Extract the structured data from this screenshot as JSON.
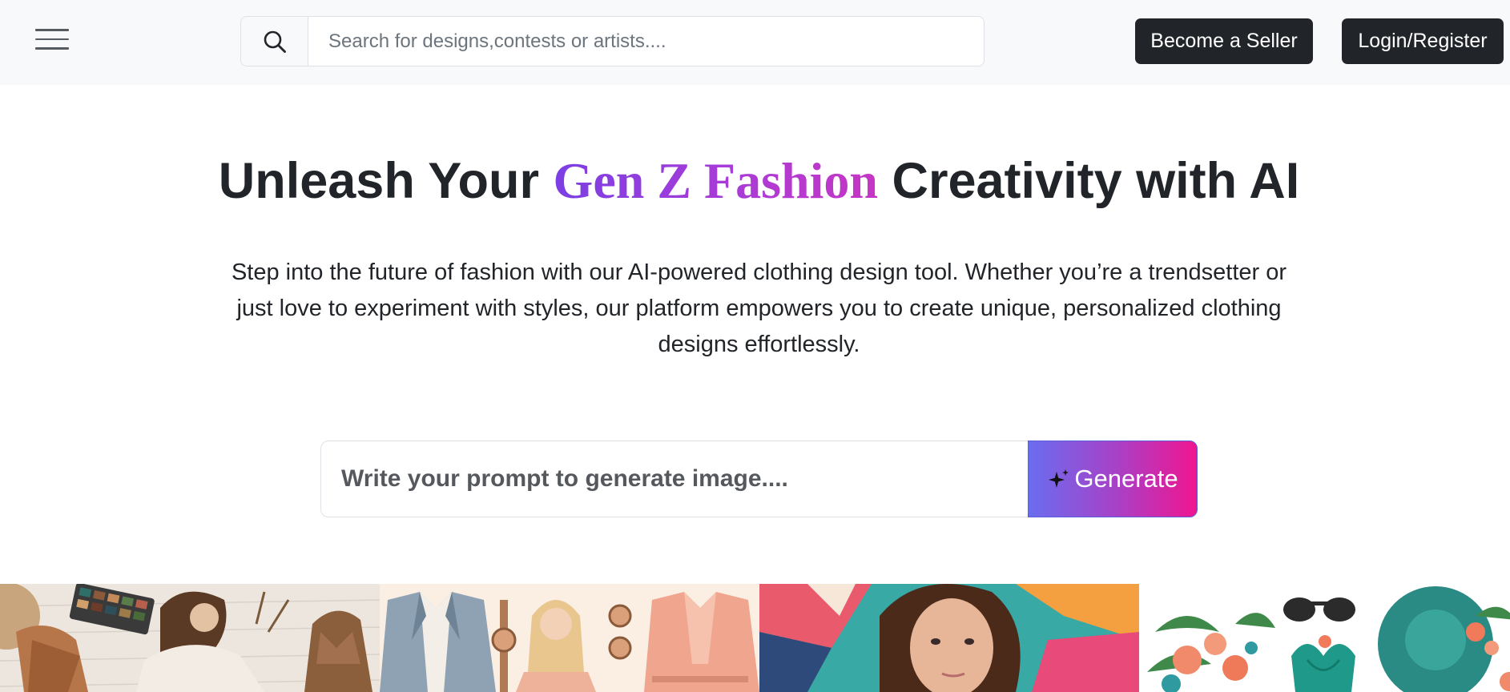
{
  "header": {
    "menu_icon": "hamburger-icon",
    "search": {
      "icon": "search-icon",
      "placeholder": "Search for designs,contests or artists....",
      "value": ""
    },
    "become_seller_label": "Become a Seller",
    "login_label": "Login/Register"
  },
  "hero": {
    "title_before": "Unleash Your ",
    "title_accent": "Gen Z Fashion",
    "title_after": " Creativity with AI",
    "description": "Step into the future of fashion with our AI-powered clothing design tool. Whether you’re a trendsetter or just love to experiment with styles, our platform empowers you to create unique, personalized clothing designs effortlessly."
  },
  "prompt": {
    "placeholder": "Write your prompt to generate image....",
    "value": "",
    "generate_label": "Generate",
    "generate_icon": "sparkles-icon"
  },
  "gallery": {
    "images": [
      "boho-fashion-flatlay",
      "blazer-outfit-collage",
      "colorful-portrait",
      "tropical-swimwear"
    ]
  },
  "colors": {
    "header_bg": "#f8f9fa",
    "dark_button": "#212529",
    "accent_gradient_start": "#6a6df0",
    "accent_gradient_end": "#f0158f",
    "title_accent_start": "#7b3fe4",
    "title_accent_end": "#c636c4"
  }
}
